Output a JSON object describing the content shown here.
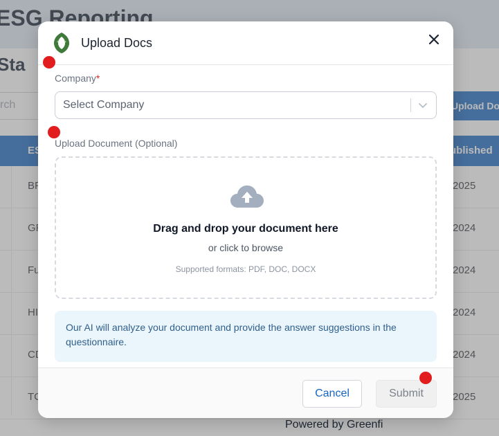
{
  "background": {
    "title": "ESG Reporting",
    "subtitle": "Sta",
    "search_placeholder": "rch",
    "upload_button": "Upload Do",
    "table": {
      "col1": "ES",
      "col2": "ublished",
      "rows": [
        {
          "left": "BF",
          "right": "2025"
        },
        {
          "left": "GF",
          "right": "2024"
        },
        {
          "left": "Fu",
          "right": "2024"
        },
        {
          "left": "HI",
          "right": "2024"
        },
        {
          "left": "CD",
          "right": "2024"
        },
        {
          "left": "TC",
          "right": "2025"
        }
      ]
    },
    "footer": "Powered by Greenfi"
  },
  "modal": {
    "title": "Upload Docs",
    "company_label": "Company",
    "required_mark": "*",
    "company_placeholder": "Select Company",
    "upload_label": "Upload Document (Optional)",
    "dropzone_title": "Drag and drop your document here",
    "dropzone_sub": "or click to browse",
    "dropzone_formats": "Supported formats: PDF, DOC, DOCX",
    "info_text": "Our AI will analyze your document and provide the answer suggestions in the questionnaire.",
    "cancel_label": "Cancel",
    "submit_label": "Submit"
  },
  "colors": {
    "primary": "#1565c0",
    "info_bg": "#ebf5fc",
    "logo_green": "#3f7a3a",
    "marker_red": "#e21d1d"
  }
}
